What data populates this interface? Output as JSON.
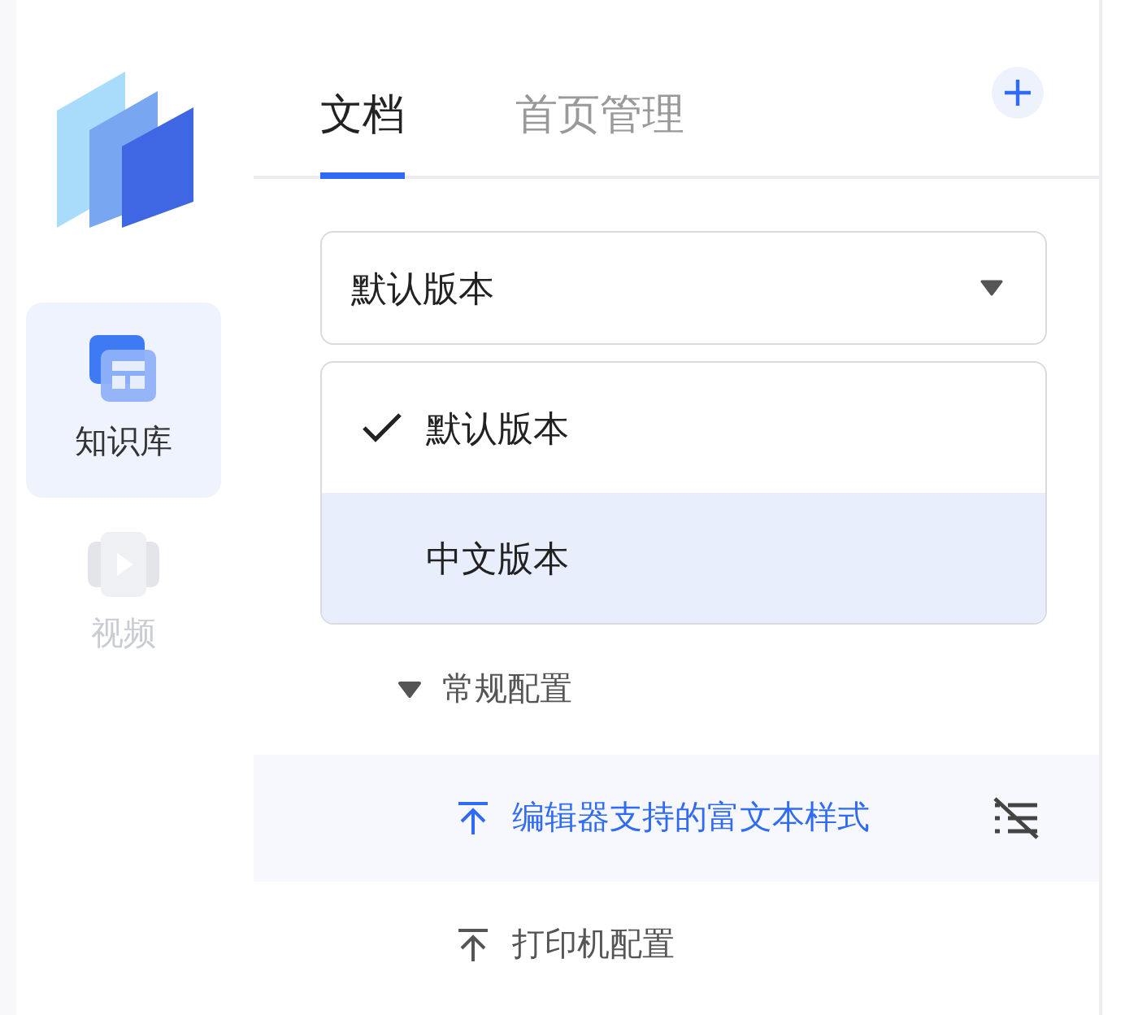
{
  "rail": {
    "items": [
      {
        "label": "知识库",
        "selected": true,
        "disabled": false
      },
      {
        "label": "视频",
        "selected": false,
        "disabled": true
      }
    ]
  },
  "tabs": [
    {
      "label": "文档",
      "selected": true
    },
    {
      "label": "首页管理",
      "selected": false
    }
  ],
  "version_select": {
    "value": "默认版本",
    "expanded": true,
    "options": [
      {
        "label": "默认版本",
        "checked": true,
        "highlighted": false
      },
      {
        "label": "中文版本",
        "checked": false,
        "highlighted": true
      }
    ]
  },
  "tree": [
    {
      "label": "常规配置",
      "expanded": true,
      "children": [
        {
          "label": "编辑器支持的富文本样式",
          "selected": true
        },
        {
          "label": "打印机配置",
          "selected": false
        }
      ]
    }
  ]
}
